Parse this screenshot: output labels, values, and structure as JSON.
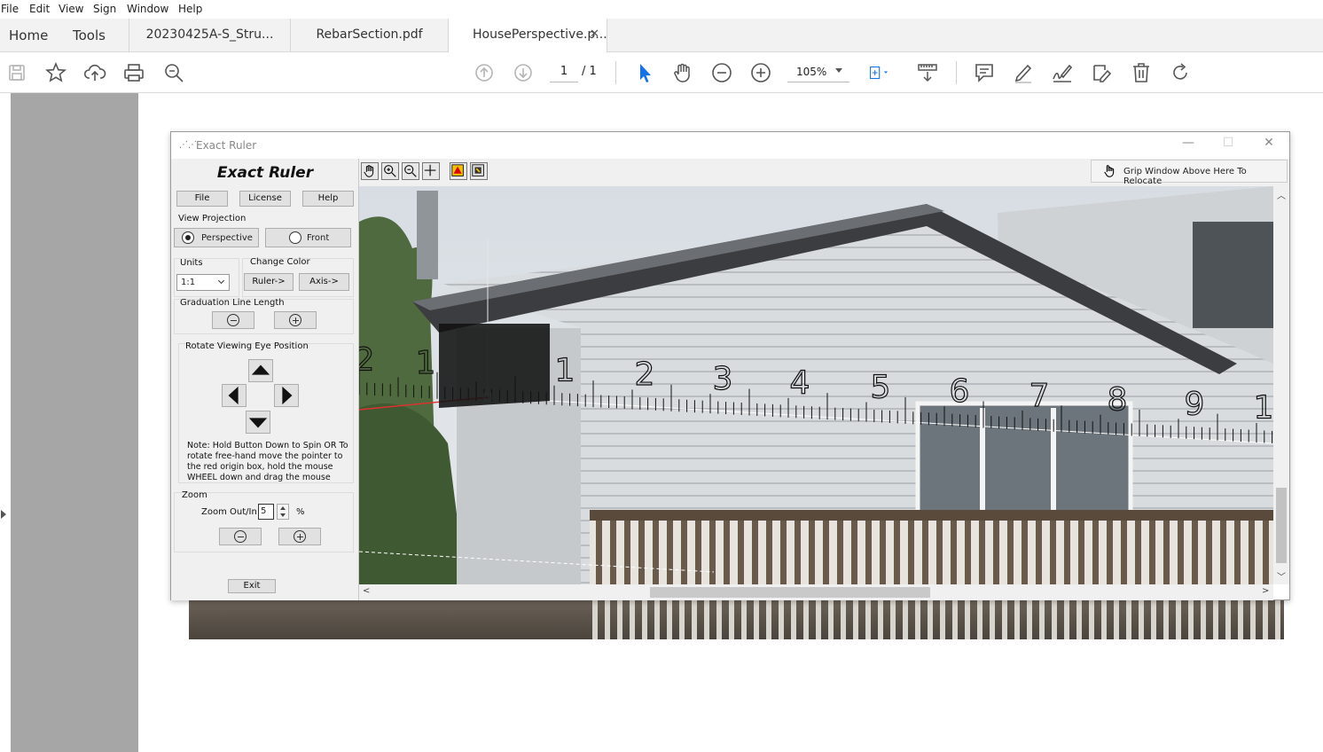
{
  "menu": [
    "File",
    "Edit",
    "View",
    "Sign",
    "Window",
    "Help"
  ],
  "tabs": {
    "home": "Home",
    "tools": "Tools",
    "docs": [
      {
        "label": "20230425A-S_Stru..."
      },
      {
        "label": "RebarSection.pdf"
      },
      {
        "label": "HousePerspective.p..."
      }
    ],
    "close_glyph": "✕"
  },
  "toolbar": {
    "page_current": "1",
    "page_total": "/ 1",
    "zoom": "105%"
  },
  "icons": {
    "save": "save-icon",
    "bookmark": "star-icon",
    "upload": "upload-cloud-icon",
    "print": "printer-icon",
    "search": "zoom-search-icon",
    "prev": "arrow-up-circle-icon",
    "next": "arrow-down-circle-icon",
    "select": "cursor-arrow-icon",
    "hand": "hand-icon",
    "zoomout": "minus-circle-icon",
    "zoomin": "plus-circle-icon",
    "fit": "fit-page-icon",
    "scroll": "scroll-mode-icon",
    "comment": "comment-icon",
    "highlight": "pen-icon",
    "sign": "sign-icon",
    "edit": "edit-icon",
    "trash": "trash-icon",
    "rotate": "rotate-icon"
  },
  "ruler_window": {
    "title": "Exact Ruler",
    "brand": "Exact Ruler",
    "buttons": {
      "file": "File",
      "license": "License",
      "help": "Help",
      "exit": "Exit"
    },
    "view_projection": {
      "label": "View Projection",
      "options": [
        {
          "label": "Perspective",
          "selected": true
        },
        {
          "label": "Front",
          "selected": false
        }
      ]
    },
    "units": {
      "label": "Units",
      "value": "1:1"
    },
    "change_color": {
      "label": "Change Color",
      "ruler": "Ruler->",
      "axis": "Axis->"
    },
    "graduation": {
      "label": "Graduation Line Length"
    },
    "rotate": {
      "label": "Rotate Viewing Eye Position",
      "note": "Note:  Hold Button Down to Spin OR To rotate free-hand move the pointer to the red origin box, hold the mouse WHEEL down and drag the mouse"
    },
    "zoom": {
      "label": "Zoom",
      "field_label": "Zoom Out/In",
      "value": "5",
      "unit": "%"
    },
    "grip": "Grip Window Above Here To Relocate",
    "ruler_numbers": [
      "2",
      "1",
      "1",
      "2",
      "3",
      "4",
      "5",
      "6",
      "7",
      "8",
      "9",
      "1"
    ]
  },
  "colors": {
    "ruler_axis": "#e03030",
    "accent": "#1473e6"
  }
}
